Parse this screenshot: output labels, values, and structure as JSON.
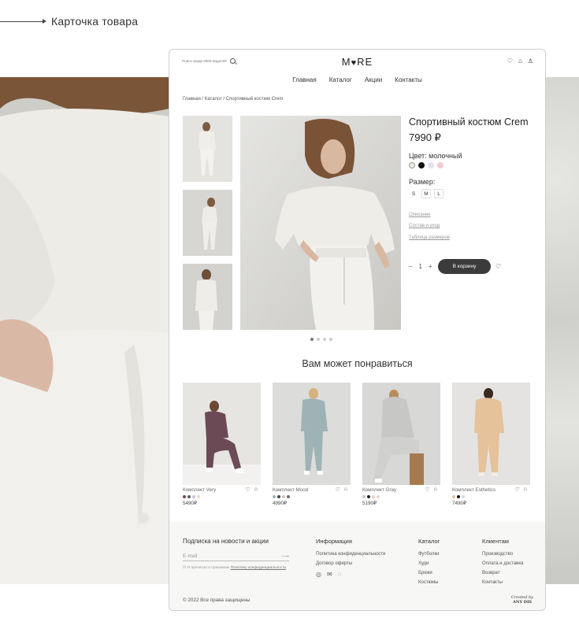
{
  "presentation": {
    "title": "Карточка товара"
  },
  "header": {
    "search_placeholder": "Поиск среди 2000 моделей",
    "logo_left": "M",
    "logo_heart": "♥",
    "logo_right": "RE",
    "icons": [
      "heart-icon",
      "bag-icon",
      "user-icon"
    ]
  },
  "nav": {
    "items": [
      "Главная",
      "Каталог",
      "Акции",
      "Контакты"
    ]
  },
  "breadcrumb": "Главная / Каталог / Спортивный костюм Crem",
  "product": {
    "title": "Спортивный костюм Crem",
    "price": "7990 ₽",
    "color_label": "Цвет: молочный",
    "colors": [
      "#ece9df",
      "#111111",
      "#dfe3f2",
      "#f2c9d2"
    ],
    "size_label": "Размер:",
    "sizes": [
      "S",
      "M",
      "L"
    ],
    "selected_size": "S",
    "links": [
      "Описание",
      "Состав и уход",
      "Таблица размеров"
    ],
    "qty_minus": "–",
    "qty": "1",
    "qty_plus": "+",
    "add_to_cart": "В корзину",
    "gallery_slides": 4,
    "active_slide": 1
  },
  "recommendations": {
    "title": "Вам может понравиться",
    "items": [
      {
        "name": "Комплект Very",
        "price": "5490₽",
        "colors": [
          "#6b4a56",
          "#555b6b",
          "#c9c4d6",
          "#f2d6c0"
        ]
      },
      {
        "name": "Комплект Mood",
        "price": "4990₽",
        "colors": [
          "#9eb3b6",
          "#444444",
          "#c8c8c8",
          "#6f6f6f"
        ]
      },
      {
        "name": "Комплект Gray",
        "price": "5190₽",
        "colors": [
          "#c6c6c6",
          "#222222",
          "#e2d5cc",
          "#f0d6c4"
        ]
      },
      {
        "name": "Комплект Esthetics",
        "price": "7490₽",
        "colors": [
          "#e6c29a",
          "#111111",
          "#d9d9d9"
        ]
      }
    ]
  },
  "footer": {
    "subscribe_title": "Подписка на новости и акции",
    "email_placeholder": "E-mail",
    "email_arrow": "⟶",
    "consent_text": "Я прочитал и принимаю",
    "consent_link": "Политику конфиденциальности",
    "info": {
      "title": "Информация",
      "items": [
        "Политика конфиденциальности",
        "Договор оферты"
      ]
    },
    "catalog": {
      "title": "Каталог",
      "items": [
        "Футболки",
        "Худи",
        "Брюки",
        "Костюмы"
      ]
    },
    "clients": {
      "title": "Клиентам",
      "items": [
        "Производство",
        "Оплата и доставка",
        "Возврат",
        "Контакты"
      ]
    },
    "copyright": "© 2022 Все права защищены",
    "created_by": "Created by",
    "created_name": "ANY DIS"
  }
}
